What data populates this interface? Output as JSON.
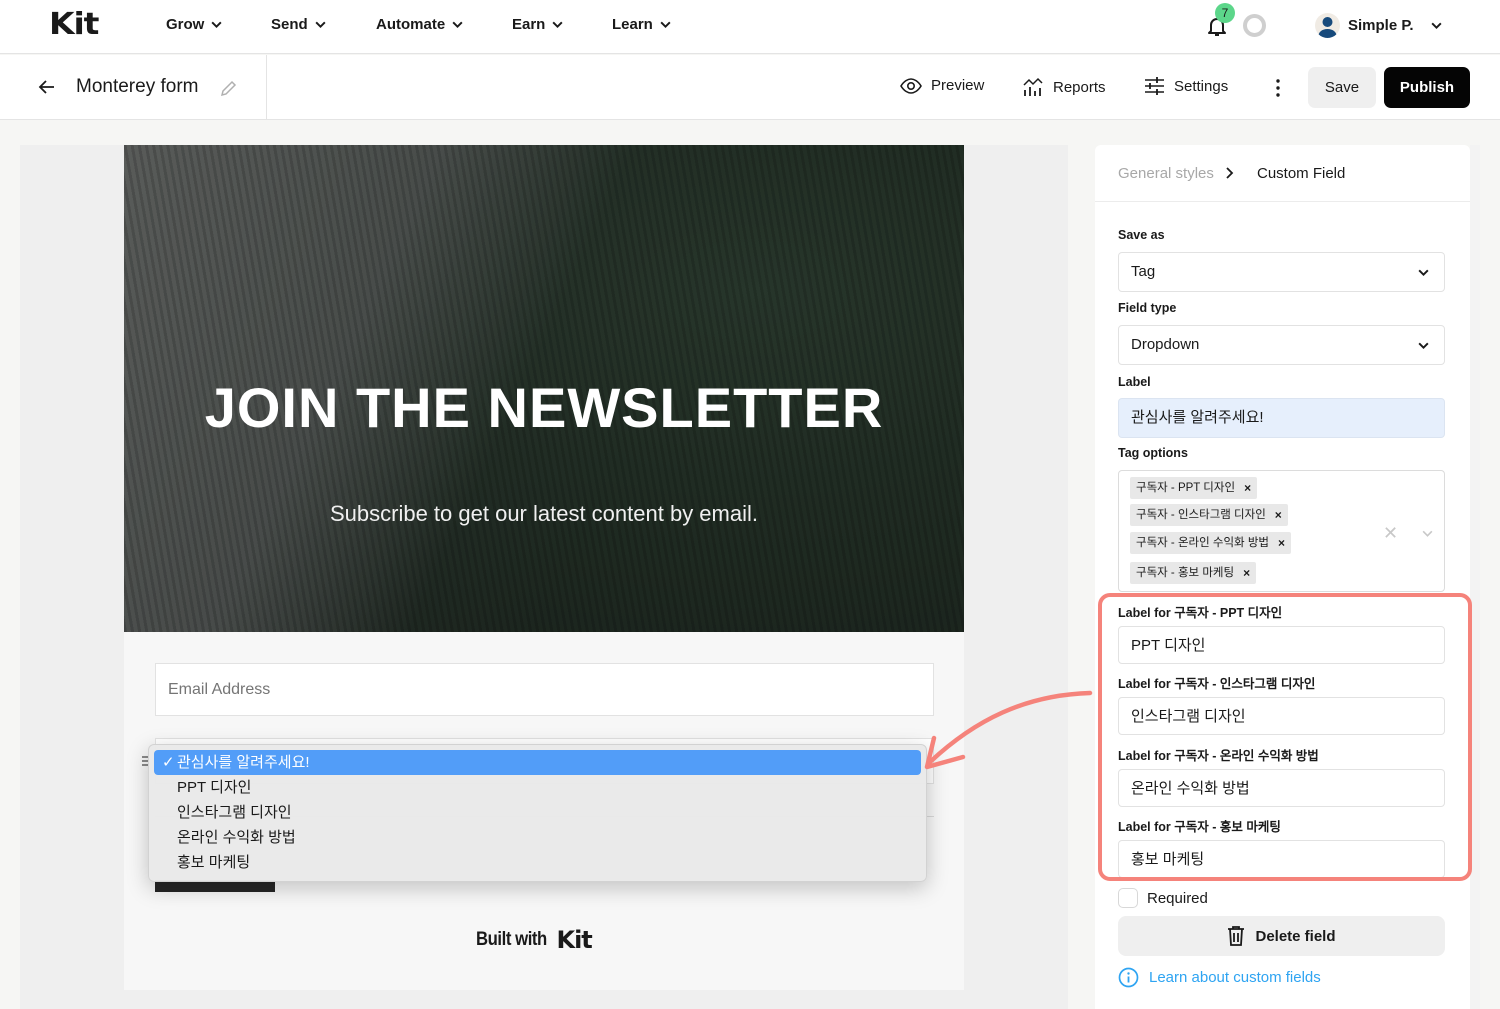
{
  "app": {
    "logo": "Kit",
    "nav": [
      {
        "label": "Grow"
      },
      {
        "label": "Send"
      },
      {
        "label": "Automate"
      },
      {
        "label": "Earn"
      },
      {
        "label": "Learn"
      }
    ],
    "notifications_count": "7",
    "user_name": "Simple P."
  },
  "editor": {
    "form_title": "Monterey form",
    "toolbar": {
      "preview": "Preview",
      "reports": "Reports",
      "settings": "Settings",
      "save": "Save",
      "publish": "Publish"
    }
  },
  "form": {
    "headline": "JOIN THE NEWSLETTER",
    "subheadline": "Subscribe to get our latest content by email.",
    "email_placeholder": "Email Address",
    "dropdown": {
      "selected": "관심사를 알려주세요!",
      "check": "✓",
      "options": [
        "관심사를 알려주세요!",
        "PPT 디자인",
        "인스타그램 디자인",
        "온라인 수익화 방법",
        "홍보 마케팅"
      ]
    },
    "built_with": "Built with",
    "built_with_logo": "Kit"
  },
  "panel": {
    "breadcrumb": {
      "parent": "General styles",
      "current": "Custom Field"
    },
    "save_as": {
      "label": "Save as",
      "value": "Tag"
    },
    "field_type": {
      "label": "Field type",
      "value": "Dropdown"
    },
    "label_field": {
      "label": "Label",
      "value": "관심사를 알려주세요!"
    },
    "tag_options": {
      "label": "Tag options",
      "tags": [
        "구독자 - PPT 디자인",
        "구독자 - 인스타그램 디자인",
        "구독자 - 온라인 수익화 방법",
        "구독자 - 홍보 마케팅"
      ],
      "remove_glyph": "×",
      "clear_glyph": "✕"
    },
    "option_labels": [
      {
        "label": "Label for 구독자 - PPT 디자인",
        "value": "PPT 디자인"
      },
      {
        "label": "Label for 구독자 - 인스타그램 디자인",
        "value": "인스타그램 디자인"
      },
      {
        "label": "Label for 구독자 - 온라인 수익화 방법",
        "value": "온라인 수익화 방법"
      },
      {
        "label": "Label for 구독자 - 홍보 마케팅",
        "value": "홍보 마케팅"
      }
    ],
    "required": {
      "label": "Required",
      "checked": false
    },
    "delete_button": "Delete field",
    "learn_link": "Learn about custom fields"
  },
  "colors": {
    "accent_link": "#2ea4f2",
    "selected_option": "#529df8",
    "annotation": "#f5837b",
    "badge": "#5cd68a",
    "publish_bg": "#050505"
  }
}
